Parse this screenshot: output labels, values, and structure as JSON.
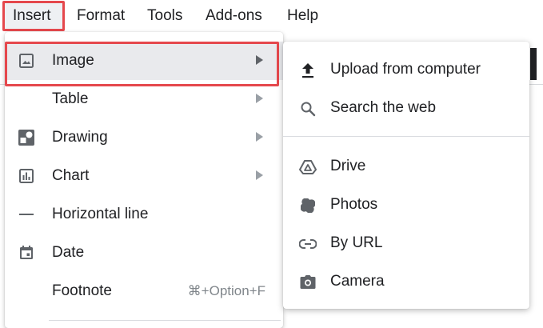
{
  "menubar": {
    "items": [
      "Insert",
      "Format",
      "Tools",
      "Add-ons",
      "Help"
    ]
  },
  "insert_menu": {
    "items": [
      {
        "label": "Image",
        "icon": "image-icon",
        "submenu": true,
        "active": true
      },
      {
        "label": "Table",
        "icon": "",
        "submenu": true
      },
      {
        "label": "Drawing",
        "icon": "drawing-icon",
        "submenu": true
      },
      {
        "label": "Chart",
        "icon": "chart-icon",
        "submenu": true
      },
      {
        "label": "Horizontal line",
        "icon": "horizontal-line-icon",
        "submenu": false
      },
      {
        "label": "Date",
        "icon": "calendar-icon",
        "submenu": false
      },
      {
        "label": "Footnote",
        "icon": "",
        "submenu": false,
        "shortcut": "⌘+Option+F"
      }
    ]
  },
  "image_submenu": {
    "items": [
      {
        "label": "Upload from computer",
        "icon": "upload-icon"
      },
      {
        "label": "Search the web",
        "icon": "search-icon"
      },
      {
        "label": "Drive",
        "icon": "drive-icon"
      },
      {
        "label": "Photos",
        "icon": "photos-icon"
      },
      {
        "label": "By URL",
        "icon": "link-icon"
      },
      {
        "label": "Camera",
        "icon": "camera-icon"
      }
    ]
  },
  "colors": {
    "highlight_outline": "#e5484d",
    "active_row_bg": "#e9eaed",
    "icon": "#5f6368",
    "text": "#202124"
  }
}
